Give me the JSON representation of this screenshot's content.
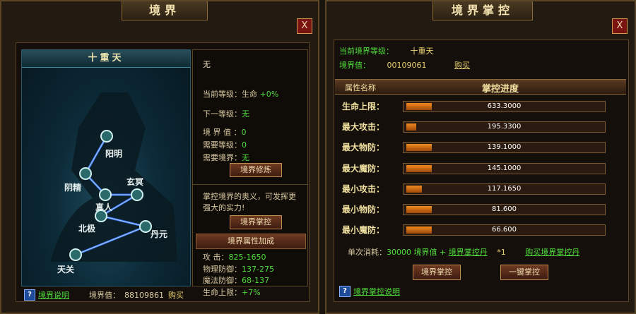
{
  "left": {
    "title": "境界",
    "realm_name": "十重天",
    "nodes": [
      "阳明",
      "阴精",
      "玄冥",
      "真人",
      "北极",
      "丹元",
      "天关"
    ],
    "info": {
      "current_name": "无",
      "current_level_label": "当前等级：",
      "current_level_value": "生命",
      "current_level_bonus": "+0%",
      "next_level_label": "下一等级：",
      "next_level_value": "无",
      "realm_value_label": "境 界 值 ：",
      "realm_value": "0",
      "required_level_label": "需要等级：",
      "required_level_value": "0",
      "required_realm_label": "需要境界：",
      "required_realm_value": "无",
      "train_button": "境界修炼",
      "master_hint": "掌控境界的奥义，可发挥更强大的实力!",
      "master_button": "境界掌控",
      "attr_header": "境界属性加成",
      "attrs": [
        {
          "label": "攻    击：",
          "value": "825-1650"
        },
        {
          "label": "物理防御：",
          "value": "137-275"
        },
        {
          "label": "魔法防御：",
          "value": "68-137"
        },
        {
          "label": "生命上限：",
          "value": "+7%"
        }
      ]
    },
    "footer": {
      "help_icon": "?",
      "help_link": "境界说明",
      "realm_value_label": "境界值：",
      "realm_value": "88109861",
      "buy_link": "购买"
    }
  },
  "right": {
    "title": "境界掌控",
    "current_realm_label": "当前境界等级：",
    "current_realm_value": "十重天",
    "realm_value_label": "境界值：",
    "realm_value": "00109061",
    "buy_link": "购买",
    "header_attr": "属性名称",
    "header_progress": "掌控进度",
    "rows": [
      {
        "label": "生命上限：",
        "value": "633.3000",
        "fill": 0.13
      },
      {
        "label": "最大攻击：",
        "value": "195.3300",
        "fill": 0.05
      },
      {
        "label": "最大物防：",
        "value": "139.1000",
        "fill": 0.13
      },
      {
        "label": "最大魔防：",
        "value": "145.1000",
        "fill": 0.13
      },
      {
        "label": "最小攻击：",
        "value": "117.1650",
        "fill": 0.08
      },
      {
        "label": "最小物防：",
        "value": "81.600",
        "fill": 0.13
      },
      {
        "label": "最小魔防：",
        "value": "66.600",
        "fill": 0.13
      }
    ],
    "cost_label": "单次消耗：",
    "cost_amount": "30000 境界值 + ",
    "cost_item": "境界掌控丹",
    "cost_qty": "*1",
    "buy_item_link": "购买境界掌控丹",
    "master_button": "境界掌控",
    "one_click_button": "一键掌控",
    "help_icon": "?",
    "help_link": "境界掌控说明"
  },
  "close_glyph": "X"
}
